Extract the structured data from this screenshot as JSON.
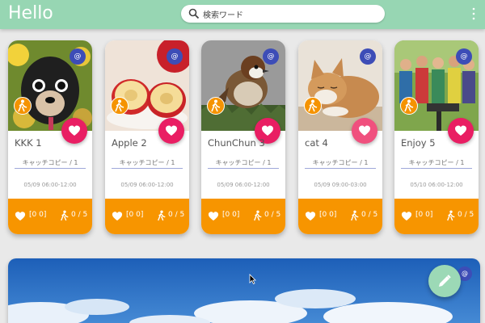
{
  "app": {
    "title": "Hello"
  },
  "search": {
    "placeholder": "検索ワード"
  },
  "cards": [
    {
      "title": "KKK 1",
      "copy": "キャッチコピー / 1",
      "time": "05/09 06:00-12:00",
      "fav_label": "[0 0]",
      "count": "0 / 5",
      "badge": "@",
      "image": "dog"
    },
    {
      "title": "Apple 2",
      "copy": "キャッチコピー / 1",
      "time": "05/09 06:00-12:00",
      "fav_label": "[0 0]",
      "count": "0 / 5",
      "badge": "@",
      "image": "apple"
    },
    {
      "title": "ChunChun 3",
      "copy": "キャッチコピー / 1",
      "time": "05/09 06:00-12:00",
      "fav_label": "[0 0]",
      "count": "0 / 5",
      "badge": "@",
      "image": "sparrow"
    },
    {
      "title": "cat 4",
      "copy": "キャッチコピー / 1",
      "time": "05/09 09:00-03:00",
      "fav_label": "[0 0]",
      "count": "0 / 5",
      "badge": "@",
      "image": "cat"
    },
    {
      "title": "Enjoy 5",
      "copy": "キャッチコピー / 1",
      "time": "05/10 06:00-12:00",
      "fav_label": "[0 0]",
      "count": "0 / 5",
      "badge": "@",
      "image": "people"
    }
  ],
  "banner": {
    "badge": "@",
    "image": "sky"
  },
  "colors": {
    "appbar": "#97d6b3",
    "accent_orange": "#f79500",
    "fav_pink": "#e91e63",
    "badge_indigo": "#3d4db7"
  },
  "icons": [
    "search-icon",
    "more-vert-icon",
    "heart-icon",
    "walk-icon",
    "pencil-icon"
  ]
}
